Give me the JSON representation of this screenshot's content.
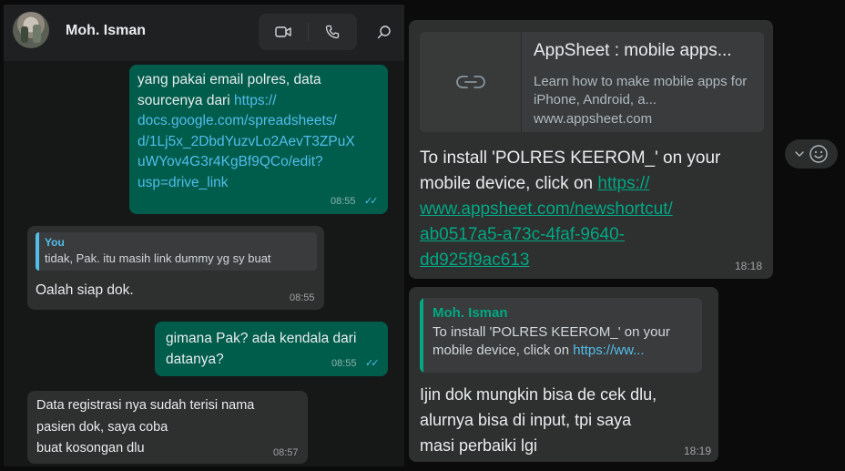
{
  "header": {
    "contact_name": "Moh. Isman"
  },
  "left_chat": {
    "msg1": {
      "text_before": "yang pakai email polres, data\nsourcenya dari ",
      "link": "https://\ndocs.google.com/spreadsheets/\nd/1Lj5x_2DbdYuzvLo2AevT3ZPuX\nuWYov4G3r4KgBf9QCo/edit?\nusp=drive_link",
      "time": "08:55"
    },
    "msg2": {
      "quote_author": "You",
      "quote_text": "tidak, Pak. itu masih link dummy yg sy buat",
      "text": "Oalah siap dok.",
      "time": "08:55"
    },
    "msg3": {
      "text": "gimana Pak? ada kendala dari\ndatanya?",
      "time": "08:55"
    },
    "msg4": {
      "text": "Data registrasi nya sudah terisi nama\npasien dok, saya coba\nbuat kosongan dlu",
      "time": "08:57"
    }
  },
  "right_chat": {
    "msg1": {
      "preview_title": "AppSheet : mobile apps...",
      "preview_desc": "Learn how to make mobile apps for iPhone, Android, a...",
      "preview_host": "www.appsheet.com",
      "text_before": "To install 'POLRES KEEROM_' on your mobile device, click on ",
      "link": "https://\nwww.appsheet.com/newshortcut/\nab0517a5-a73c-4faf-9640-\ndd925f9ac613",
      "time": "18:18"
    },
    "msg2": {
      "quote_author": "Moh. Isman",
      "quote_text_before": "To install 'POLRES KEEROM_' on your mobile device, click on ",
      "quote_link": "https://ww...",
      "text": "Ijin dok mungkin bisa de cek dlu,\nalurnya bisa di input, tpi saya\nmasi perbaiki lgi",
      "time": "18:19"
    }
  },
  "icons": {
    "video": "video-call-icon",
    "phone": "voice-call-icon",
    "search": "search-icon",
    "link": "link-icon",
    "chevron": "chevron-down-icon",
    "emoji": "emoji-icon"
  },
  "colors": {
    "outgoing_bubble": "#005c4b",
    "incoming_bubble": "#2e2f2f",
    "accent": "#00a884",
    "read_ticks": "#53bdeb",
    "link_blue": "#53bdeb"
  }
}
